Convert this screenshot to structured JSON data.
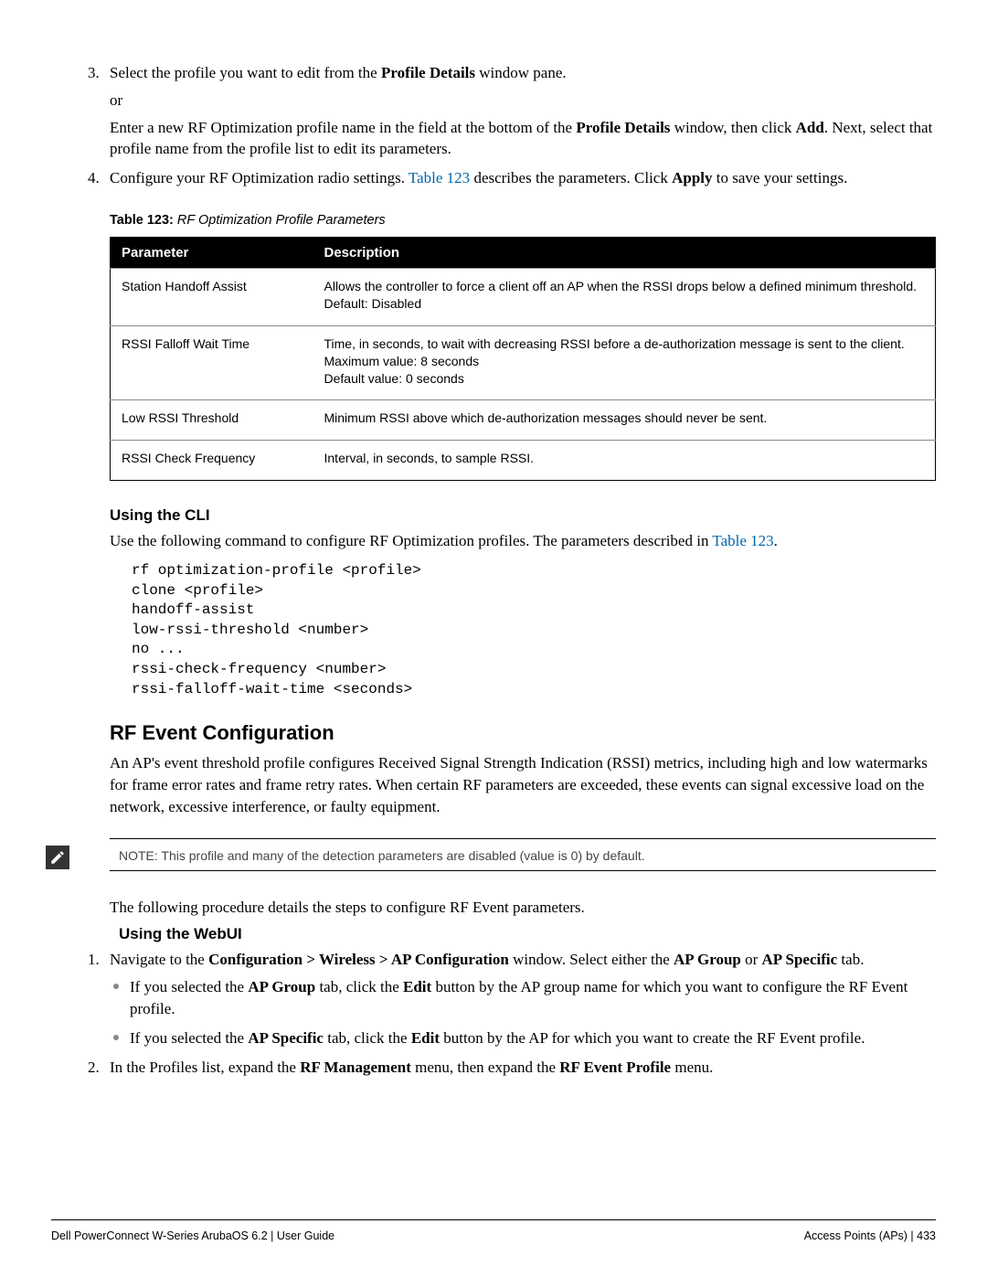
{
  "step3": {
    "main": [
      "Select the profile you want to edit from the ",
      "Profile Details",
      " window pane."
    ],
    "or": "or",
    "alt": [
      "Enter a new RF Optimization profile name in the field at the bottom of the ",
      "Profile Details",
      " window, then click ",
      "Add",
      ". Next, select that profile name from the profile list to edit its parameters."
    ]
  },
  "step4": {
    "parts": [
      "Configure your RF Optimization radio settings. ",
      "Table 123",
      " describes the parameters. Click ",
      "Apply",
      " to save your settings."
    ]
  },
  "table_caption": {
    "label": "Table 123:",
    "title": " RF Optimization Profile Parameters"
  },
  "table": {
    "hdr_param": "Parameter",
    "hdr_desc": "Description",
    "rows": [
      {
        "param": "Station Handoff Assist",
        "desc": "Allows the controller to force a client off an AP when the RSSI drops below a defined minimum threshold.\nDefault: Disabled"
      },
      {
        "param": "RSSI Falloff Wait Time",
        "desc": "Time, in seconds, to wait with decreasing RSSI before a de-authorization message is sent to the client.\nMaximum value: 8 seconds\nDefault value: 0 seconds"
      },
      {
        "param": "Low RSSI Threshold",
        "desc": "Minimum RSSI above which de-authorization messages should never be sent."
      },
      {
        "param": "RSSI Check Frequency",
        "desc": "Interval, in seconds, to sample RSSI."
      }
    ]
  },
  "cli": {
    "heading": "Using the CLI",
    "intro": [
      "Use the following command to configure RF Optimization profiles. The parameters described in ",
      "Table 123",
      "."
    ],
    "code": "rf optimization-profile <profile>\nclone <profile>\nhandoff-assist\nlow-rssi-threshold <number>\nno ...\nrssi-check-frequency <number>\nrssi-falloff-wait-time <seconds>"
  },
  "rfevent": {
    "heading": "RF Event Configuration",
    "intro": "An AP's event threshold profile configures Received Signal Strength Indication (RSSI) metrics, including high and low watermarks for frame error rates and frame retry rates. When certain RF parameters are exceeded, these events can signal excessive load on the network, excessive interference, or faulty equipment.",
    "note": "NOTE: This profile and many of the detection parameters are disabled (value is 0) by default.",
    "followup": "The following procedure details the steps to configure RF Event parameters.",
    "webui_heading": "Using the WebUI",
    "step1": [
      "Navigate to the ",
      "Configuration > Wireless > AP Configuration",
      " window. Select either the ",
      "AP Group",
      " or ",
      "AP Specific",
      " tab."
    ],
    "bullet1": [
      "If you selected the ",
      "AP Group",
      " tab, click the ",
      "Edit",
      " button by the AP group name for which you want to configure the RF Event profile."
    ],
    "bullet2": [
      "If you selected the ",
      "AP Specific",
      " tab, click the ",
      "Edit",
      " button by the AP for which you want to create the RF Event profile."
    ],
    "step2": [
      "In the Profiles list, expand the ",
      "RF Management",
      " menu, then expand the ",
      "RF Event Profile",
      " menu."
    ]
  },
  "footer": {
    "left": "Dell PowerConnect W-Series ArubaOS 6.2  |  User Guide",
    "right": "Access Points (APs)  |  433"
  }
}
